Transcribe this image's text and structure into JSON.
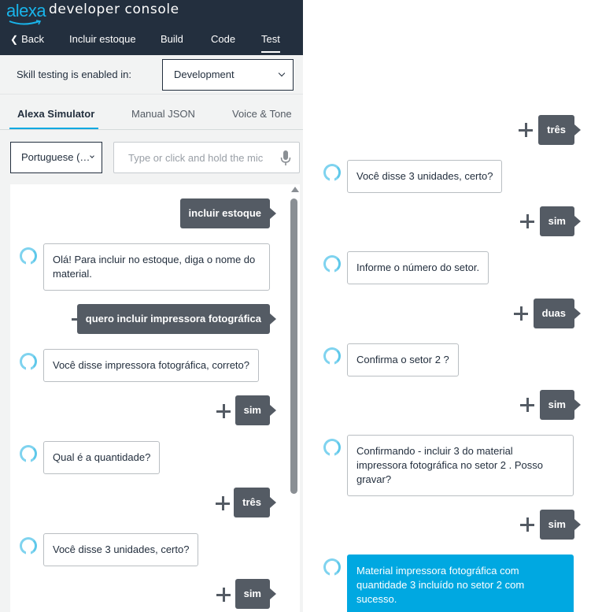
{
  "header": {
    "logo_text": "alexa",
    "title": "developer console",
    "nav": {
      "back": "Back",
      "skill": "Incluir estoque",
      "build": "Build",
      "code": "Code",
      "test": "Test"
    }
  },
  "testing": {
    "label": "Skill testing is enabled in:",
    "selected": "Development"
  },
  "tabs": {
    "simulator": "Alexa Simulator",
    "manual_json": "Manual JSON",
    "voice_tone": "Voice & Tone"
  },
  "language": {
    "selected": "Portuguese (…"
  },
  "utterance": {
    "placeholder": "Type or click and hold the mic"
  },
  "colors": {
    "header_bg": "#232f3e",
    "accent": "#00a8e1",
    "user_bubble": "#545b64",
    "alexa_ring": "#7fd3ef"
  },
  "left_chat": [
    {
      "from": "user",
      "text": "incluir estoque"
    },
    {
      "from": "alexa",
      "text": "Olá! Para incluir no estoque, diga o nome do material."
    },
    {
      "from": "user",
      "text": "quero incluir impressora fotográfica"
    },
    {
      "from": "alexa",
      "text": "Você disse impressora fotográfica, correto?"
    },
    {
      "from": "user",
      "text": "sim"
    },
    {
      "from": "alexa",
      "text": "Qual é a quantidade?"
    },
    {
      "from": "user",
      "text": "três"
    },
    {
      "from": "alexa",
      "text": "Você disse 3 unidades, certo?"
    },
    {
      "from": "user",
      "text": "sim"
    }
  ],
  "right_chat": [
    {
      "from": "user",
      "text": "três"
    },
    {
      "from": "alexa",
      "text": "Você disse 3 unidades, certo?"
    },
    {
      "from": "user",
      "text": "sim"
    },
    {
      "from": "alexa",
      "text": "Informe o número do setor."
    },
    {
      "from": "user",
      "text": "duas"
    },
    {
      "from": "alexa",
      "text": "Confirma o setor 2 ?"
    },
    {
      "from": "user",
      "text": "sim"
    },
    {
      "from": "alexa",
      "text": "Confirmando - incluir 3 do material impressora fotográfica no setor 2 . Posso gravar?"
    },
    {
      "from": "user",
      "text": "sim"
    },
    {
      "from": "alexa",
      "text": "Material impressora fotográfica com quantidade 3 incluído no setor 2 com sucesso."
    }
  ]
}
